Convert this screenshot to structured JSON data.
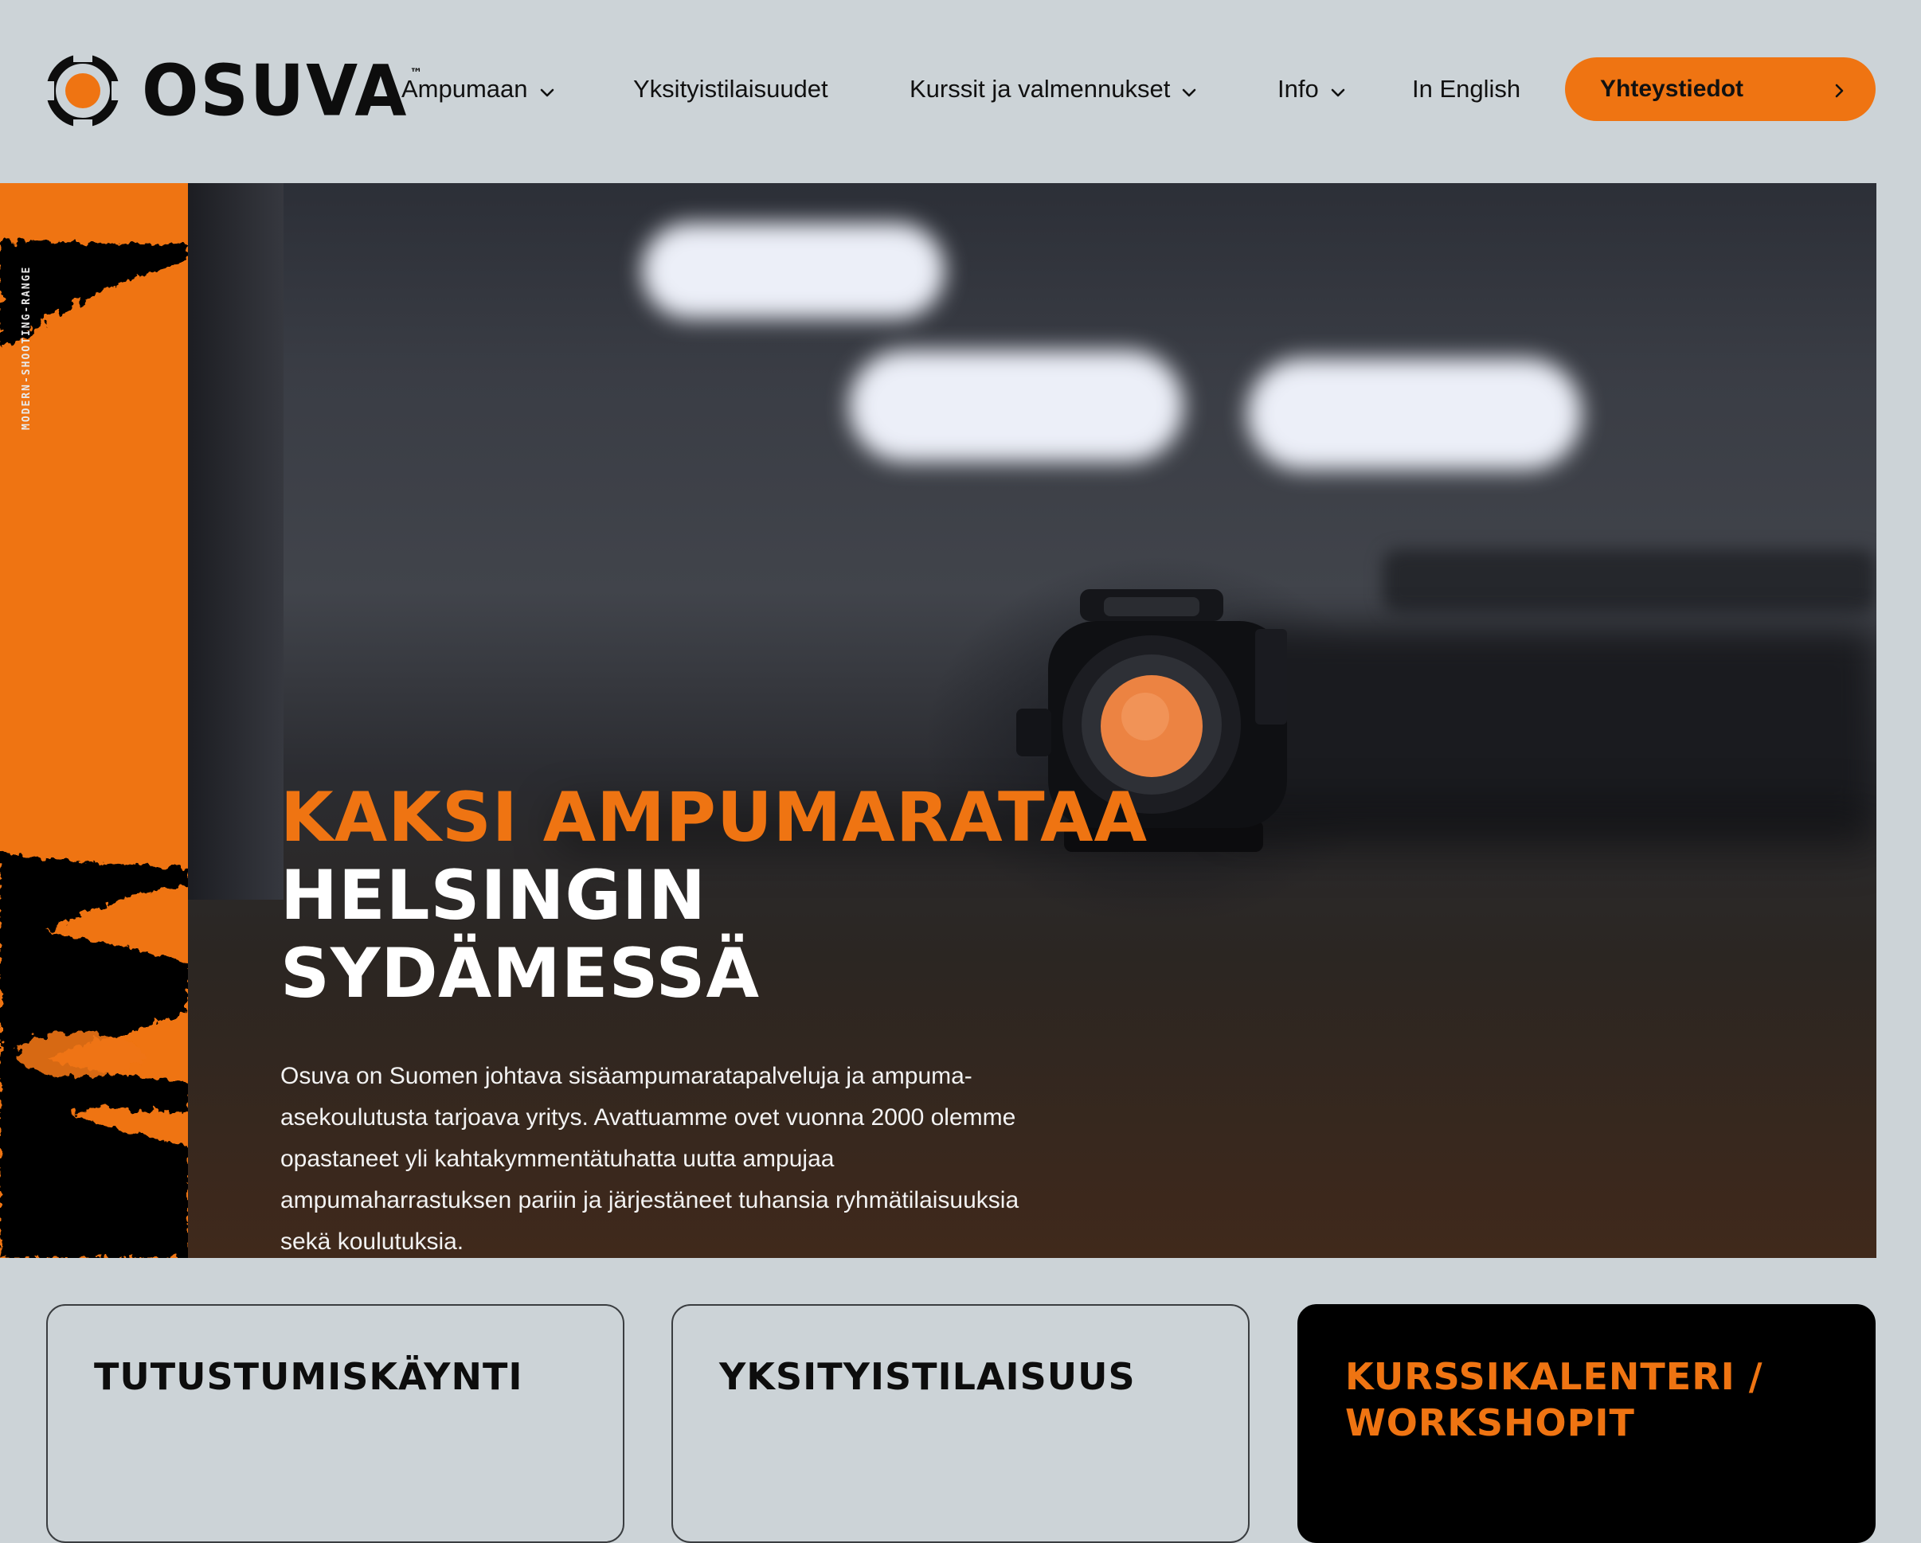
{
  "brand": {
    "name": "OSUVA",
    "trademark": "™",
    "accent_color": "#ef7412",
    "background_color": "#ccd3d7"
  },
  "nav": {
    "items": [
      {
        "label": "Ampumaan",
        "has_dropdown": true,
        "icon": "chevron-down-icon"
      },
      {
        "label": "Yksityistilaisuudet",
        "has_dropdown": false
      },
      {
        "label": "Kurssit ja valmennukset",
        "has_dropdown": true,
        "icon": "chevron-down-icon"
      },
      {
        "label": "Info",
        "has_dropdown": true,
        "icon": "chevron-down-icon"
      },
      {
        "label": "In English",
        "has_dropdown": false
      }
    ],
    "cta_label": "Yhteystiedot",
    "cta_icon": "chevron-right-icon"
  },
  "hero": {
    "side_label": "MODERN-SHOOTING-RANGE",
    "title_line1": "KAKSI AMPUMARATAA",
    "title_line2": "HELSINGIN",
    "title_line3": "SYDÄMESSÄ",
    "description": "Osuva on Suomen johtava sisäampumaratapalveluja ja ampuma-asekoulutusta tarjoava yritys. Avattuamme ovet vuonna 2000 olemme opastaneet yli kahtakymmentätuhatta uutta ampujaa ampumaharrastuksen pariin ja järjestäneet tuhansia ryhmätilaisuuksia sekä koulutuksia."
  },
  "cards": [
    {
      "title": "TUTUSTUMISKÄYNTI",
      "style": "outline"
    },
    {
      "title": "YKSITYISTILAISUUS",
      "style": "outline"
    },
    {
      "title": "KURSSIKALENTERI / WORKSHOPIT",
      "style": "dark"
    }
  ]
}
